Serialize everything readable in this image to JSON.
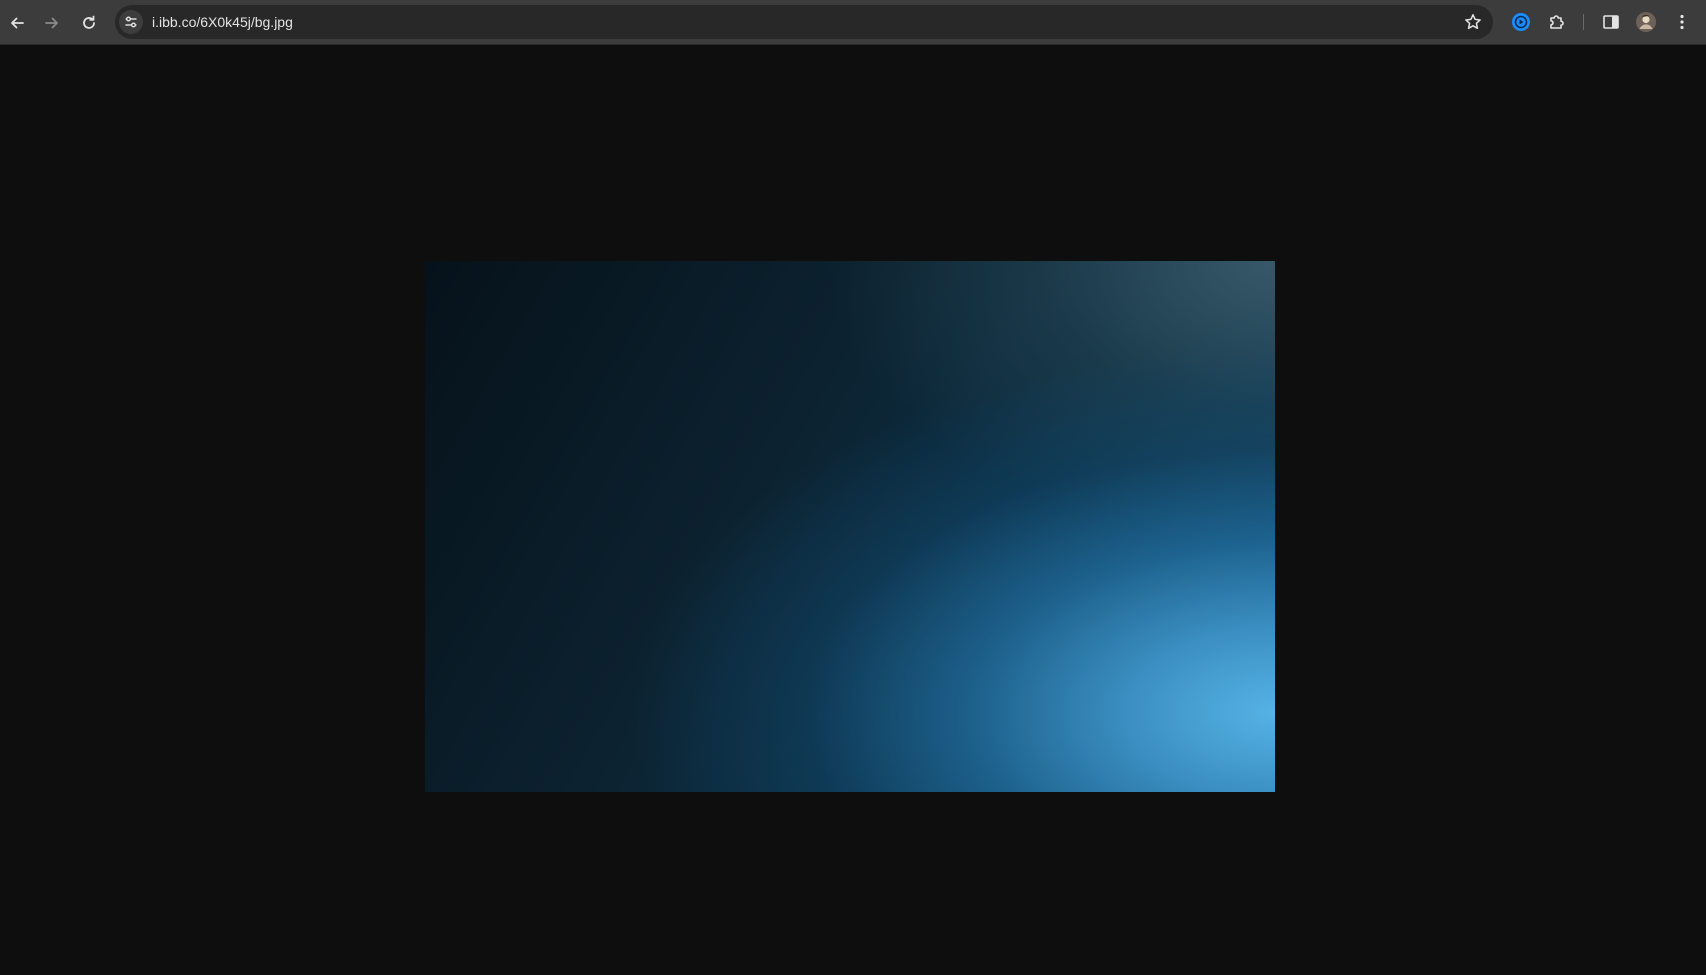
{
  "browser": {
    "url": "i.ibb.co/6X0k45j/bg.jpg",
    "icons": {
      "back": "arrow-left-icon",
      "forward": "arrow-right-icon",
      "reload": "reload-icon",
      "site_info": "tune-icon",
      "bookmark": "star-icon",
      "extension_1": "media-extension-icon",
      "extensions": "puzzle-icon",
      "side_panel": "side-panel-icon",
      "profile": "avatar",
      "menu": "kebab-menu-icon"
    },
    "colors": {
      "toolbar": "#3c3c3c",
      "omnibox": "#282828",
      "page_background": "#0e0e0e",
      "extension_accent": "#1a8cff"
    }
  }
}
